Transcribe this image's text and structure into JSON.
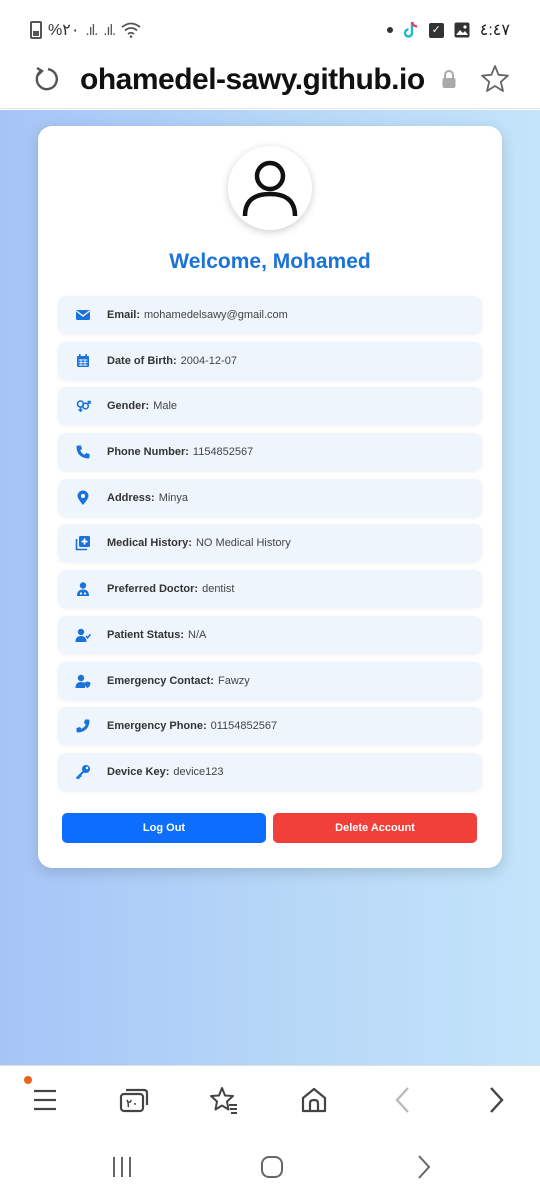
{
  "status_bar": {
    "battery_text": "%٢٠",
    "time": "٤:٤٧"
  },
  "url_bar": {
    "url": "ohamedel-sawy.github.io"
  },
  "profile": {
    "welcome": "Welcome, Mohamed",
    "fields": [
      {
        "icon": "email-icon",
        "label": "Email:",
        "value": "mohamedelsawy@gmail.com"
      },
      {
        "icon": "calendar-icon",
        "label": "Date of Birth:",
        "value": "2004-12-07"
      },
      {
        "icon": "gender-icon",
        "label": "Gender:",
        "value": "Male"
      },
      {
        "icon": "phone-icon",
        "label": "Phone Number:",
        "value": "1154852567"
      },
      {
        "icon": "location-icon",
        "label": "Address:",
        "value": "Minya"
      },
      {
        "icon": "medical-history-icon",
        "label": "Medical History:",
        "value": "NO Medical History"
      },
      {
        "icon": "doctor-icon",
        "label": "Preferred Doctor:",
        "value": "dentist"
      },
      {
        "icon": "user-check-icon",
        "label": "Patient Status:",
        "value": "N/A"
      },
      {
        "icon": "user-shield-icon",
        "label": "Emergency Contact:",
        "value": "Fawzy"
      },
      {
        "icon": "phone-alt-icon",
        "label": "Emergency Phone:",
        "value": "01154852567"
      },
      {
        "icon": "key-icon",
        "label": "Device Key:",
        "value": "device123"
      }
    ],
    "logout_label": "Log Out",
    "delete_label": "Delete Account"
  },
  "browser_nav": {
    "tab_count": "٢٠"
  },
  "colors": {
    "accent": "#1a73d9",
    "logout": "#0d6efd",
    "delete": "#f1403a",
    "row_bg": "#eef5fd"
  }
}
